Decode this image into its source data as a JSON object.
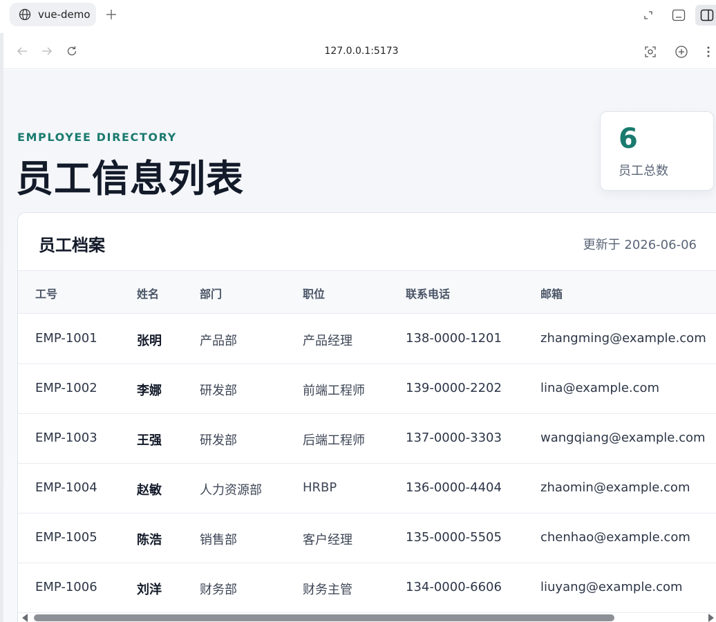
{
  "browser": {
    "tab_title": "vue-demo",
    "url": "127.0.0.1:5173",
    "icons": [
      "globe-icon",
      "new-tab-icon",
      "fullscreen-icon",
      "minimize-icon",
      "sidebar-icon",
      "back-icon",
      "forward-icon",
      "reload-icon",
      "screenshot-icon",
      "zoom-icon",
      "menu-icon"
    ]
  },
  "header": {
    "eyebrow": "EMPLOYEE DIRECTORY",
    "title": "员工信息列表"
  },
  "stat": {
    "count": "6",
    "label": "员工总数"
  },
  "card": {
    "title": "员工档案",
    "updated": "更新于 2026-06-06"
  },
  "table": {
    "headers": [
      "工号",
      "姓名",
      "部门",
      "职位",
      "联系电话",
      "邮箱"
    ],
    "rows": [
      {
        "id": "EMP-1001",
        "name": "张明",
        "dept": "产品部",
        "position": "产品经理",
        "phone": "138-0000-1201",
        "email": "zhangming@example.com"
      },
      {
        "id": "EMP-1002",
        "name": "李娜",
        "dept": "研发部",
        "position": "前端工程师",
        "phone": "139-0000-2202",
        "email": "lina@example.com"
      },
      {
        "id": "EMP-1003",
        "name": "王强",
        "dept": "研发部",
        "position": "后端工程师",
        "phone": "137-0000-3303",
        "email": "wangqiang@example.com"
      },
      {
        "id": "EMP-1004",
        "name": "赵敏",
        "dept": "人力资源部",
        "position": "HRBP",
        "phone": "136-0000-4404",
        "email": "zhaomin@example.com"
      },
      {
        "id": "EMP-1005",
        "name": "陈浩",
        "dept": "销售部",
        "position": "客户经理",
        "phone": "135-0000-5505",
        "email": "chenhao@example.com"
      },
      {
        "id": "EMP-1006",
        "name": "刘洋",
        "dept": "财务部",
        "position": "财务主管",
        "phone": "134-0000-6606",
        "email": "liuyang@example.com"
      }
    ]
  },
  "colors": {
    "accent": "#1a7a6e",
    "title": "#131a29",
    "muted": "#5a6577"
  }
}
